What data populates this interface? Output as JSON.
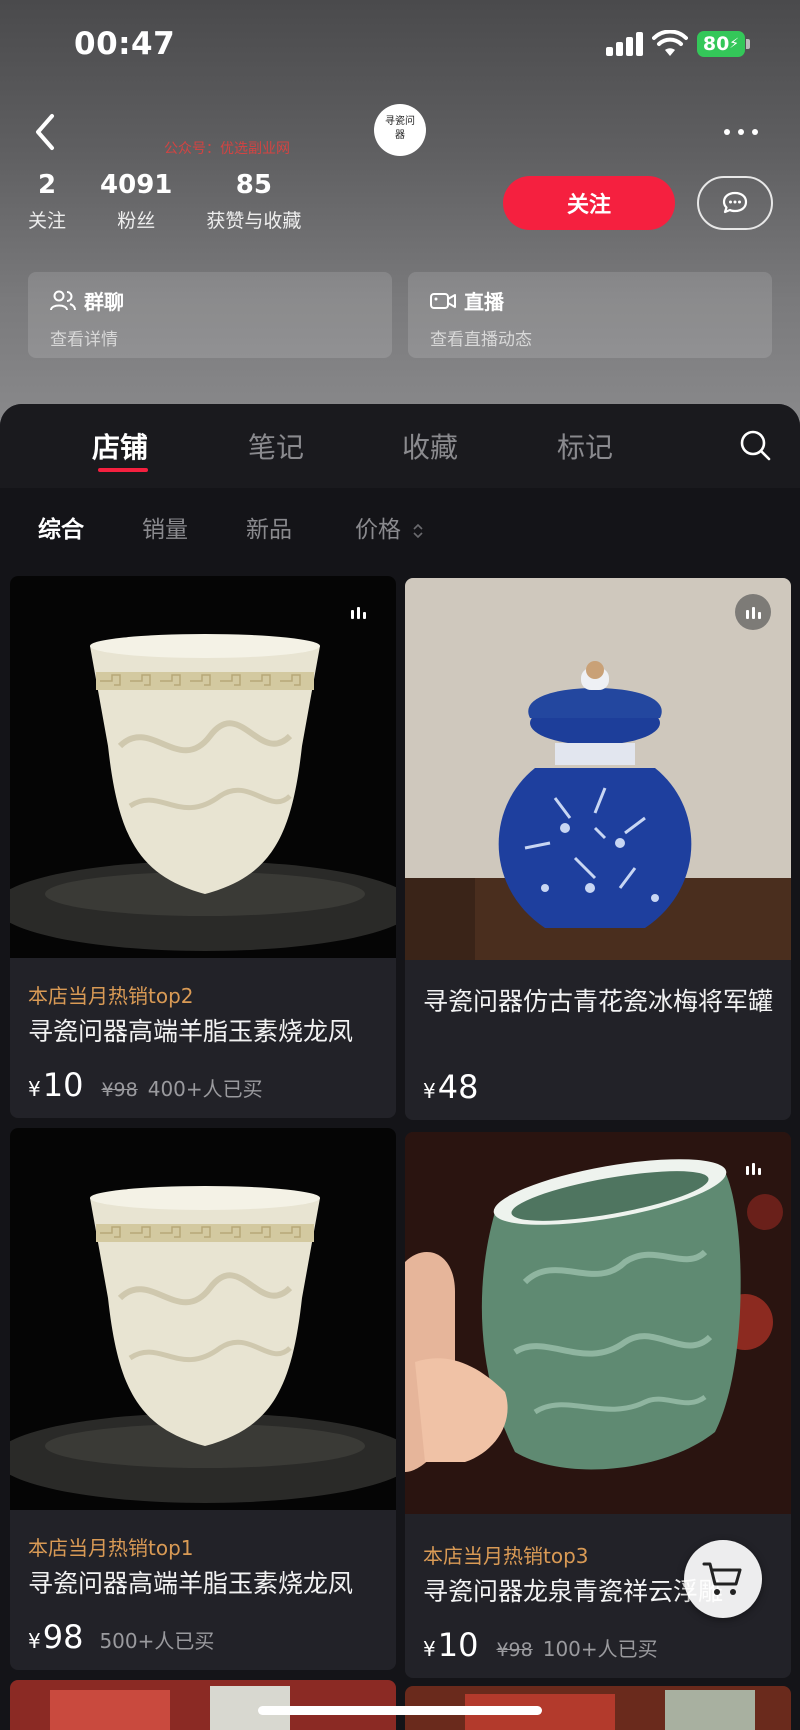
{
  "status_bar": {
    "time": "00:47",
    "battery": "80"
  },
  "profile": {
    "avatar_text": "寻瓷问器",
    "watermark": "公众号：优选副业网",
    "stats": [
      {
        "num": "2",
        "label": "关注"
      },
      {
        "num": "4091",
        "label": "粉丝"
      },
      {
        "num": "85",
        "label": "获赞与收藏"
      }
    ],
    "follow_label": "关注",
    "cards": [
      {
        "icon": "group-icon",
        "title": "群聊",
        "subtitle": "查看详情"
      },
      {
        "icon": "video-camera-icon",
        "title": "直播",
        "subtitle": "查看直播动态"
      }
    ]
  },
  "tabs": [
    {
      "label": "店铺",
      "active": true
    },
    {
      "label": "笔记",
      "active": false
    },
    {
      "label": "收藏",
      "active": false
    },
    {
      "label": "标记",
      "active": false
    }
  ],
  "filters": [
    {
      "label": "综合",
      "active": true
    },
    {
      "label": "销量",
      "active": false
    },
    {
      "label": "新品",
      "active": false
    },
    {
      "label": "价格",
      "active": false
    }
  ],
  "products": [
    {
      "tag": "本店当月热销top2",
      "title": "寻瓷问器高端羊脂玉素烧龙凤",
      "currency": "¥",
      "price": "10",
      "original_price": "¥98",
      "sold": "400+人已买"
    },
    {
      "tag": "",
      "title": "寻瓷问器仿古青花瓷冰梅将军罐",
      "currency": "¥",
      "price": "48",
      "original_price": "",
      "sold": ""
    },
    {
      "tag": "本店当月热销top1",
      "title": "寻瓷问器高端羊脂玉素烧龙凤",
      "currency": "¥",
      "price": "98",
      "original_price": "",
      "sold": "500+人已买"
    },
    {
      "tag": "本店当月热销top3",
      "title": "寻瓷问器龙泉青瓷祥云浮雕",
      "currency": "¥",
      "price": "10",
      "original_price": "¥98",
      "sold": "100+人已买"
    }
  ],
  "colors": {
    "accent": "#f5203f",
    "tag": "#d99a55",
    "battery": "#34c759"
  }
}
